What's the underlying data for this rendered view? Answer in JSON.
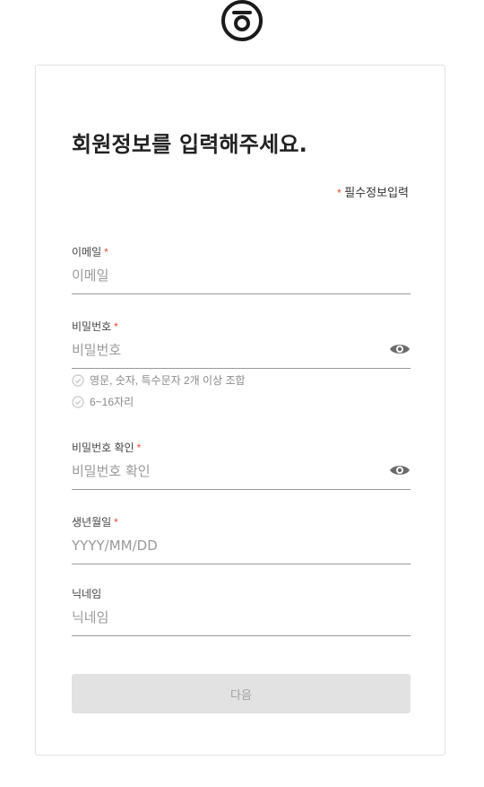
{
  "title": "회원정보를 입력해주세요.",
  "required_note": {
    "star": "*",
    "label": "필수정보입력"
  },
  "fields": {
    "email": {
      "label": "이메일",
      "star": "*",
      "placeholder": "이메일"
    },
    "password": {
      "label": "비밀번호",
      "star": "*",
      "placeholder": "비밀번호"
    },
    "password_confirm": {
      "label": "비밀번호 확인",
      "star": "*",
      "placeholder": "비밀번호 확인"
    },
    "birthdate": {
      "label": "생년월일",
      "star": "*",
      "placeholder": "YYYY/MM/DD"
    },
    "nickname": {
      "label": "닉네임",
      "placeholder": "닉네임"
    }
  },
  "password_rules": [
    "영문, 숫자, 특수문자 2개 이상 조합",
    "6~16자리"
  ],
  "next_button": "다음",
  "icons": {
    "logo": "brand-logo-icon",
    "eye": "eye-icon",
    "check": "check-circle-icon"
  },
  "colors": {
    "required_star": "#e84a3a",
    "button_bg": "#e2e2e2",
    "button_text": "#a2a2a2"
  }
}
